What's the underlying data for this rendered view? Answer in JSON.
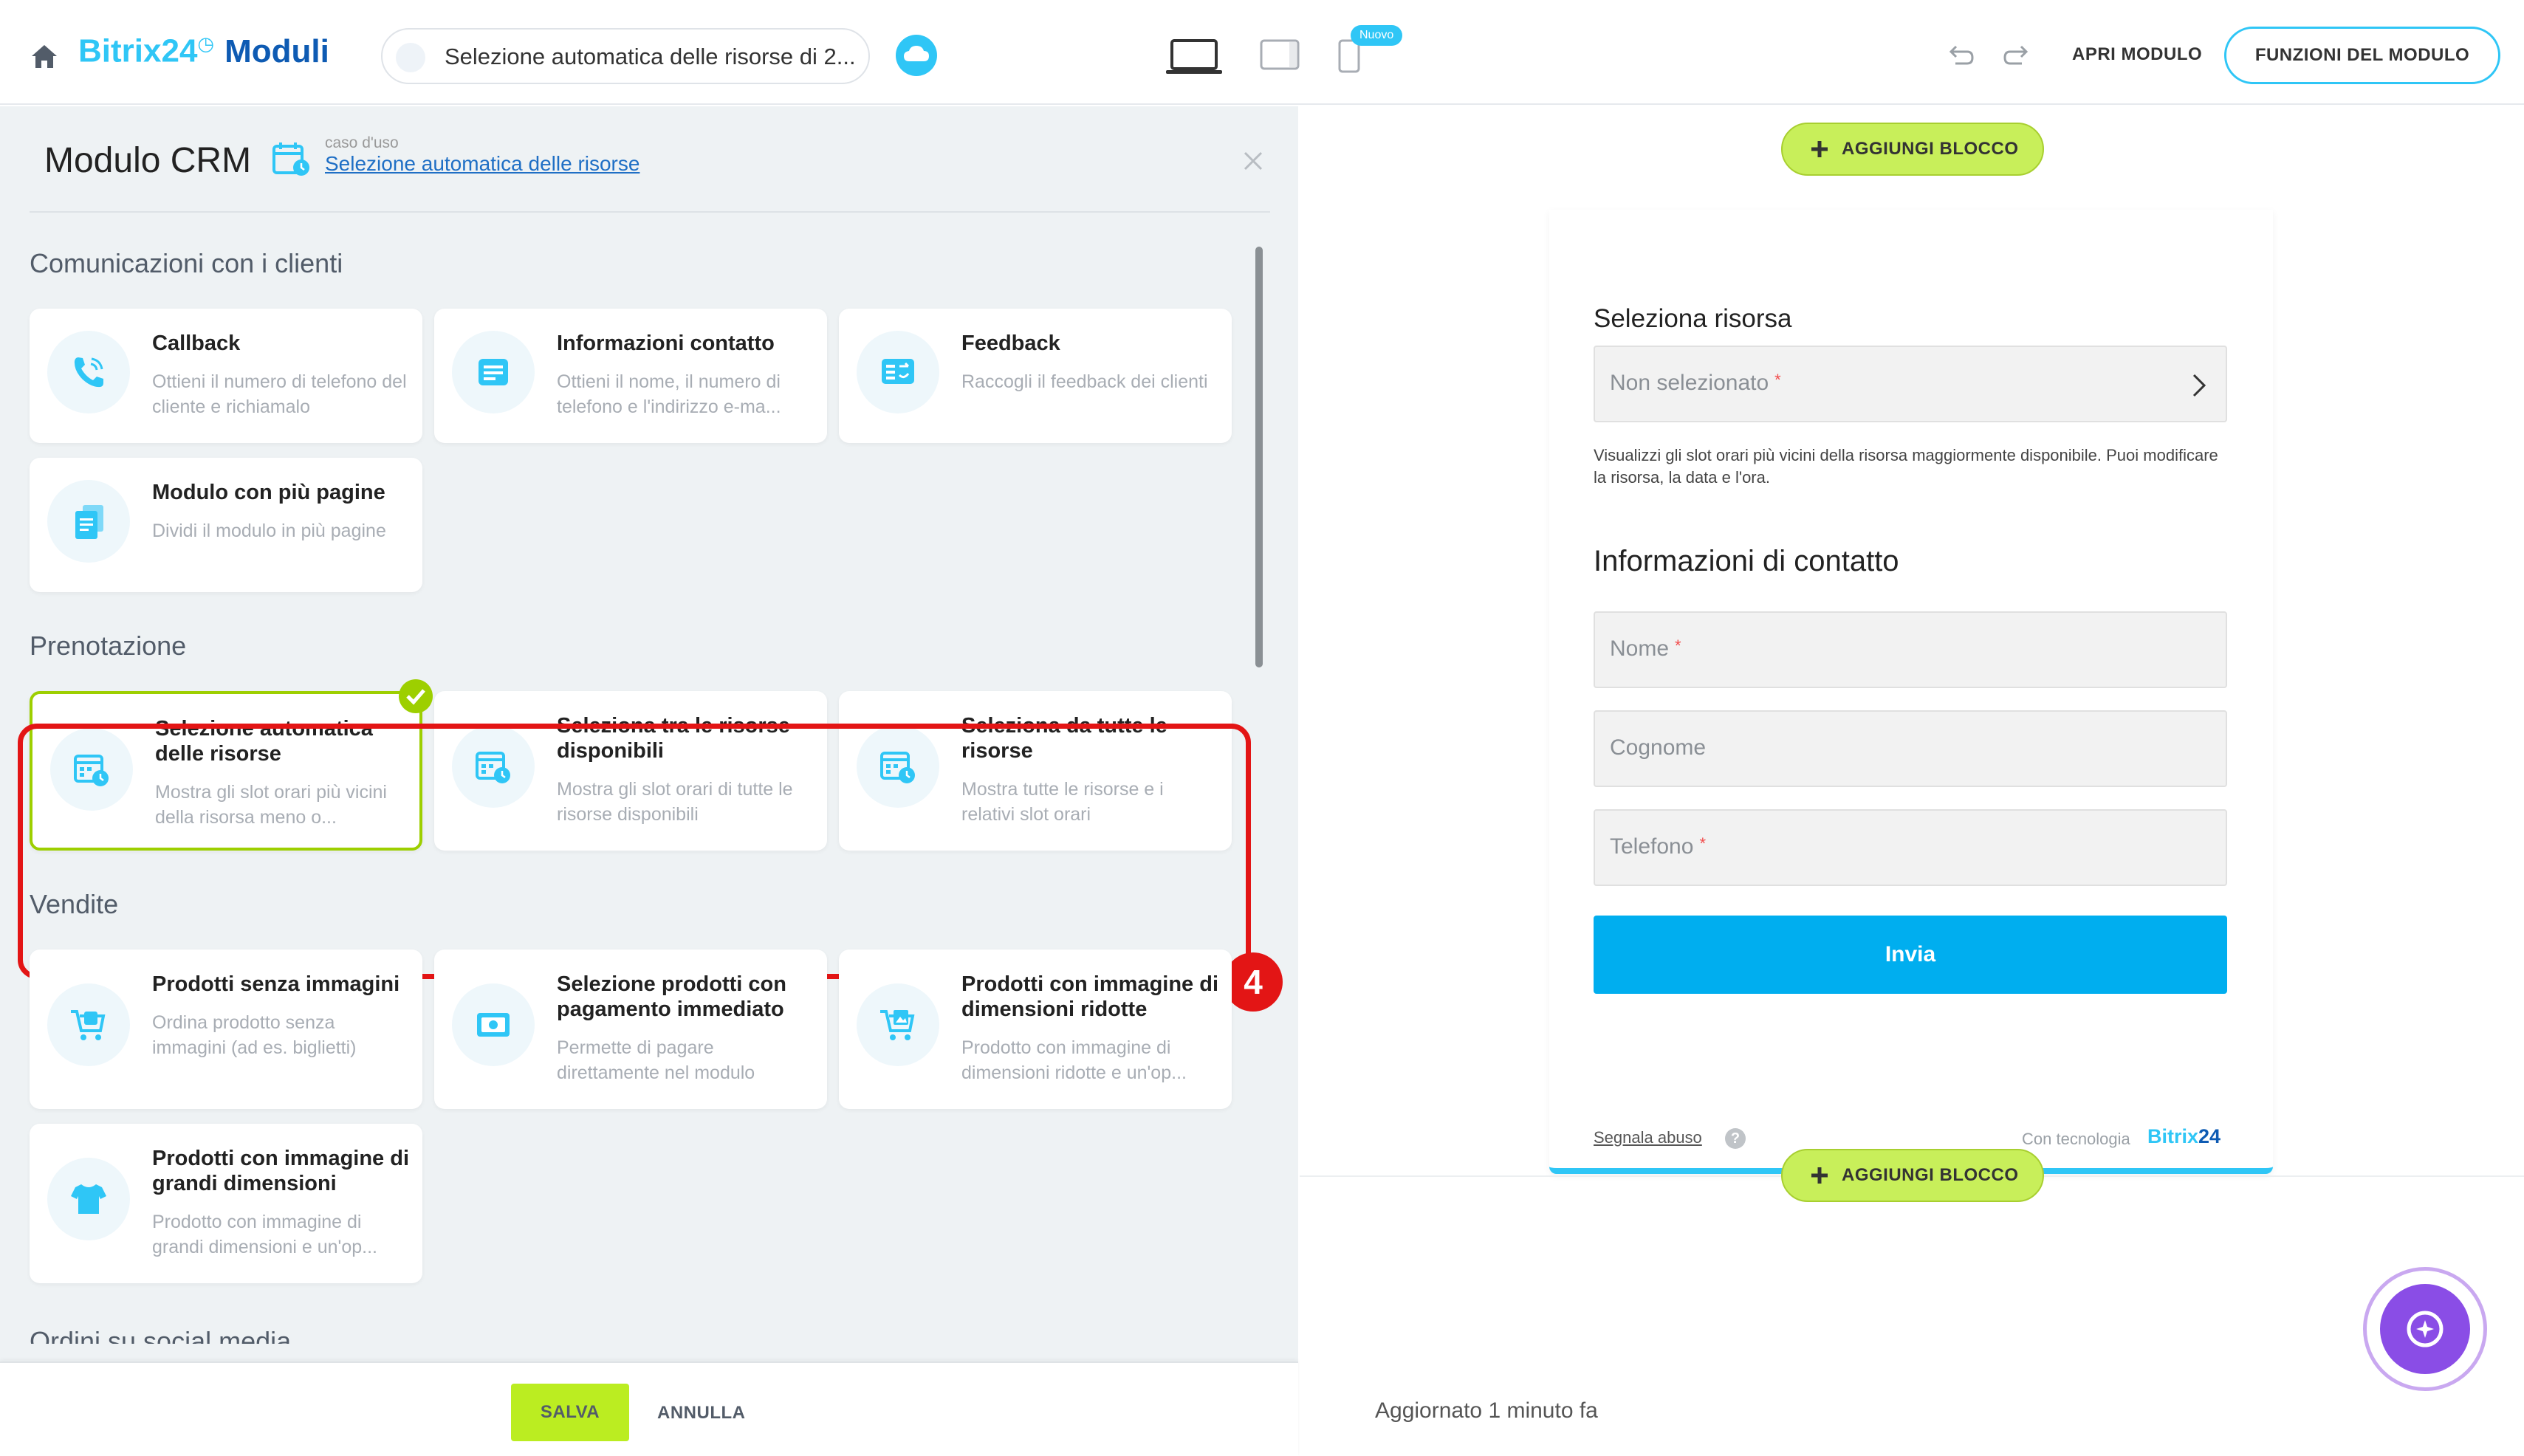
{
  "topbar": {
    "brand_prefix": "Bitrix24",
    "brand_clock": "◷",
    "brand_product": "Moduli",
    "form_name": "Selezione automatica delle risorse di 2...",
    "new_badge": "Nuovo",
    "open_form": "APRI MODULO",
    "form_functions": "FUNZIONI DEL MODULO",
    "accent_color": "#2fc6f6"
  },
  "left_panel": {
    "title": "Modulo CRM",
    "use_case_label": "caso d'uso",
    "use_case_link": "Selezione automatica delle risorse",
    "sections": [
      {
        "heading": "Comunicazioni con i clienti",
        "cards": [
          {
            "title": "Callback",
            "desc": "Ottieni il numero di telefono del cliente e richiamalo",
            "icon": "phone-icon"
          },
          {
            "title": "Informazioni contatto",
            "desc": "Ottieni il nome, il numero di telefono e l'indirizzo e-ma...",
            "icon": "contact-form-icon"
          },
          {
            "title": "Feedback",
            "desc": "Raccogli il feedback dei clienti",
            "icon": "feedback-icon"
          },
          {
            "title": "Modulo con più pagine",
            "desc": "Dividi il modulo in più pagine",
            "icon": "pages-icon"
          }
        ]
      },
      {
        "heading": "Prenotazione",
        "cards": [
          {
            "title": "Selezione automatica delle risorse",
            "desc": "Mostra gli slot orari più vicini della risorsa meno o...",
            "icon": "calendar-icon",
            "selected": true
          },
          {
            "title": "Seleziona tra le risorse disponibili",
            "desc": "Mostra gli slot orari di tutte le risorse disponibili",
            "icon": "calendar-icon"
          },
          {
            "title": "Seleziona da tutte le risorse",
            "desc": "Mostra tutte le risorse e i relativi slot orari",
            "icon": "calendar-icon"
          }
        ]
      },
      {
        "heading": "Vendite",
        "cards": [
          {
            "title": "Prodotti senza immagini",
            "desc": "Ordina prodotto senza immagini (ad es. biglietti)",
            "icon": "cart-icon"
          },
          {
            "title": "Selezione prodotti con pagamento immediato",
            "desc": "Permette di pagare direttamente nel modulo",
            "icon": "payment-icon"
          },
          {
            "title": "Prodotti con immagine di dimensioni ridotte",
            "desc": "Prodotto con immagine di dimensioni ridotte e un'op...",
            "icon": "cart-image-icon"
          },
          {
            "title": "Prodotti con immagine di grandi dimensioni",
            "desc": "Prodotto con immagine di grandi dimensioni e un'op...",
            "icon": "tshirt-icon"
          }
        ]
      },
      {
        "heading": "Ordini su social media"
      }
    ],
    "annotation_number": "4",
    "save": "SALVA",
    "cancel": "ANNULLA",
    "save_color": "#bbed21",
    "highlight_color": "#e31515"
  },
  "preview": {
    "add_block": "AGGIUNGI BLOCCO",
    "resource_heading": "Seleziona risorsa",
    "resource_placeholder": "Non selezionato",
    "resource_help": "Visualizzi gli slot orari più vicini della risorsa maggiormente disponibile. Puoi modificare la risorsa, la data e l'ora.",
    "contact_heading": "Informazioni di contatto",
    "fields": [
      {
        "placeholder": "Nome",
        "required": true
      },
      {
        "placeholder": "Cognome",
        "required": false
      },
      {
        "placeholder": "Telefono",
        "required": true
      }
    ],
    "required_mark": "*",
    "submit": "Invia",
    "report_abuse": "Segnala abuso",
    "help_mark": "?",
    "powered_by": "Con tecnologia",
    "powered_brand": "Bitrix",
    "powered_brand_num": "24",
    "updated": "Aggiornato 1 minuto fa",
    "submit_color": "#00aeef"
  }
}
